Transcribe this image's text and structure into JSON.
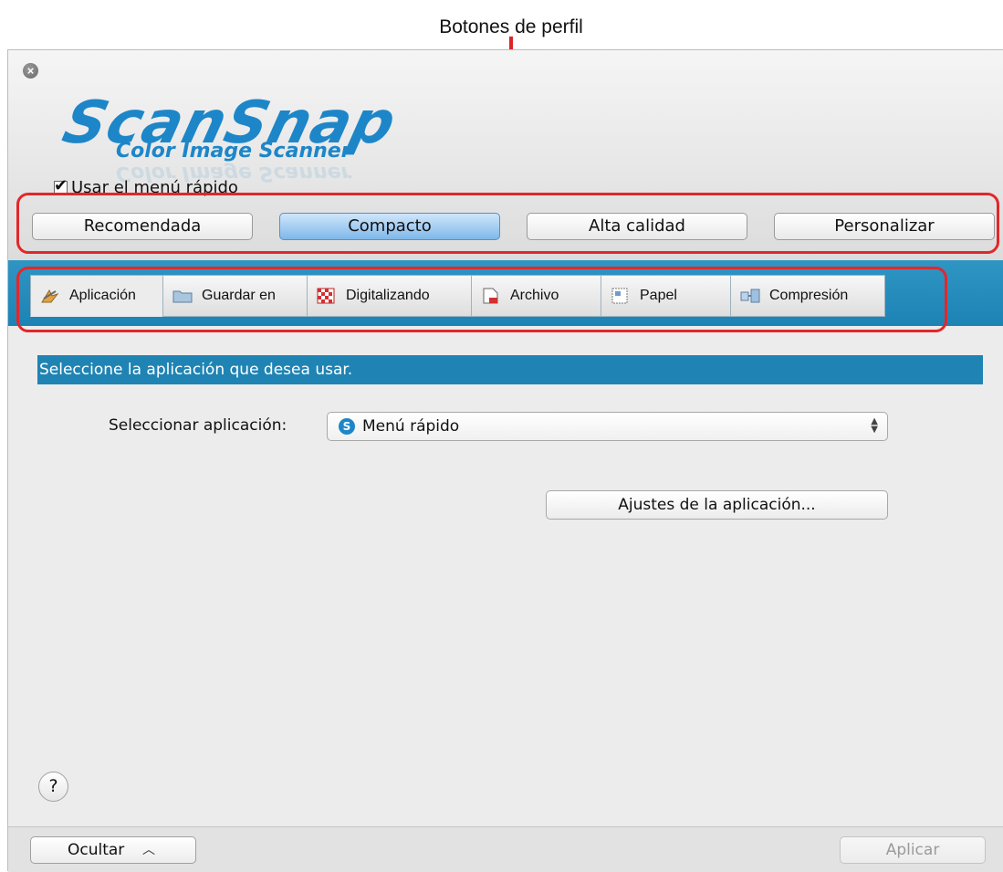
{
  "annotation": {
    "caption": "Botones de perfil"
  },
  "window": {
    "close_symbol": "×"
  },
  "logo": {
    "main": "ScanSnap",
    "sub": "Color Image Scanner"
  },
  "quick_menu": {
    "label": "Usar el menú rápido",
    "checked": true
  },
  "profiles": [
    {
      "label": "Recomendada",
      "active": false
    },
    {
      "label": "Compacto",
      "active": true
    },
    {
      "label": "Alta calidad",
      "active": false
    },
    {
      "label": "Personalizar",
      "active": false
    }
  ],
  "tabs": [
    {
      "label": "Aplicación",
      "icon": "application-icon",
      "selected": true
    },
    {
      "label": "Guardar en",
      "icon": "folder-icon",
      "selected": false
    },
    {
      "label": "Digitalizando",
      "icon": "scanning-icon",
      "selected": false
    },
    {
      "label": "Archivo",
      "icon": "file-icon",
      "selected": false
    },
    {
      "label": "Papel",
      "icon": "paper-icon",
      "selected": false
    },
    {
      "label": "Compresión",
      "icon": "compression-icon",
      "selected": false
    }
  ],
  "content": {
    "section_title": "Seleccione la aplicación que desea usar.",
    "app_label": "Seleccionar aplicación:",
    "app_value": "Menú rápido",
    "settings_button": "Ajustes de la aplicación...",
    "help_symbol": "?"
  },
  "footer": {
    "hide_label": "Ocultar",
    "apply_label": "Aplicar"
  },
  "colors": {
    "accent": "#1f84b4",
    "highlight": "#e2272b",
    "logo": "#1d86c8"
  }
}
